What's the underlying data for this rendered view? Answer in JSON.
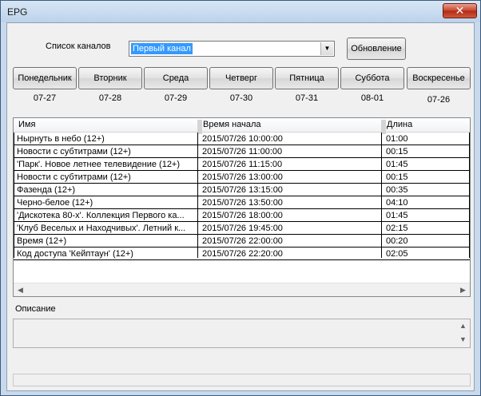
{
  "window": {
    "title": "EPG",
    "close_glyph": "✕"
  },
  "channel": {
    "label": "Список каналов",
    "selected": "Первый канал",
    "refresh_label": "Обновление"
  },
  "days": [
    {
      "label": "Понедельник",
      "date": "07-27"
    },
    {
      "label": "Вторник",
      "date": "07-28"
    },
    {
      "label": "Среда",
      "date": "07-29"
    },
    {
      "label": "Четверг",
      "date": "07-30"
    },
    {
      "label": "Пятница",
      "date": "07-31"
    },
    {
      "label": "Суббота",
      "date": "08-01"
    },
    {
      "label": "Воскресенье",
      "date": "07-26"
    }
  ],
  "table": {
    "columns": [
      "Имя",
      "Время начала",
      "Длина"
    ],
    "rows": [
      [
        "Нырнуть в небо (12+)",
        "2015/07/26  10:00:00",
        "01:00"
      ],
      [
        "Новости с субтитрами (12+)",
        "2015/07/26  11:00:00",
        "00:15"
      ],
      [
        "'Парк'. Новое летнее телевидение (12+)",
        "2015/07/26  11:15:00",
        "01:45"
      ],
      [
        "Новости с субтитрами (12+)",
        "2015/07/26  13:00:00",
        "00:15"
      ],
      [
        "Фазенда (12+)",
        "2015/07/26  13:15:00",
        "00:35"
      ],
      [
        "Черно-белое (12+)",
        "2015/07/26  13:50:00",
        "04:10"
      ],
      [
        "'Дискотека 80-х'. Коллекция Первого ка...",
        "2015/07/26  18:00:00",
        "01:45"
      ],
      [
        "'Клуб Веселых и Находчивых'. Летний к...",
        "2015/07/26  19:45:00",
        "02:15"
      ],
      [
        "Время (12+)",
        "2015/07/26  22:00:00",
        "00:20"
      ],
      [
        "Код доступа 'Кейптаун' (12+)",
        "2015/07/26  22:20:00",
        "02:05"
      ]
    ]
  },
  "description": {
    "label": "Описание",
    "value": ""
  },
  "icons": {
    "dropdown": "chevron-down-icon",
    "scroll_left": "arrow-left-icon",
    "scroll_right": "arrow-right-icon",
    "scroll_up": "arrow-up-icon",
    "scroll_down": "arrow-down-icon"
  }
}
